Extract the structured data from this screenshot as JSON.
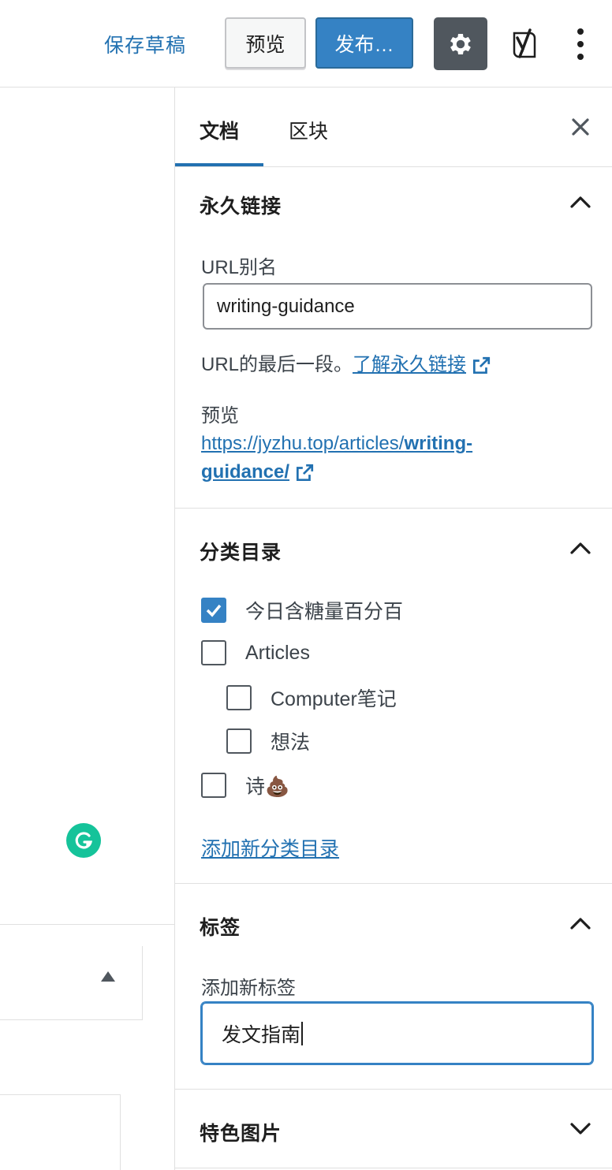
{
  "toolbar": {
    "save_draft": "保存草稿",
    "preview": "预览",
    "publish": "发布…"
  },
  "sidebar": {
    "tabs": [
      {
        "label": "文档",
        "active": true
      },
      {
        "label": "区块",
        "active": false
      }
    ],
    "permalink": {
      "title": "永久链接",
      "slug_label": "URL别名",
      "slug_value": "writing-guidance",
      "help_prefix": "URL的最后一段。",
      "help_link": "了解永久链接",
      "preview_label": "预览",
      "preview_url_base": "https://jyzhu.top/articles/",
      "preview_url_slug_1": "writing-",
      "preview_url_slug_2": "guidance/"
    },
    "categories": {
      "title": "分类目录",
      "items": [
        {
          "label": "今日含糖量百分百",
          "checked": true
        },
        {
          "label": "Articles",
          "checked": false
        },
        {
          "label": "Computer笔记",
          "checked": false
        },
        {
          "label": "想法",
          "checked": false
        },
        {
          "label": "诗💩",
          "checked": false
        }
      ],
      "add_link": "添加新分类目录"
    },
    "tags": {
      "title": "标签",
      "add_label": "添加新标签",
      "input_value": "发文指南"
    },
    "featured_image": {
      "title": "特色图片"
    }
  },
  "colors": {
    "accent": "#2271b1",
    "publish_bg": "#3582c4",
    "settings_bg": "#50575e",
    "grammarly": "#15c39a"
  }
}
